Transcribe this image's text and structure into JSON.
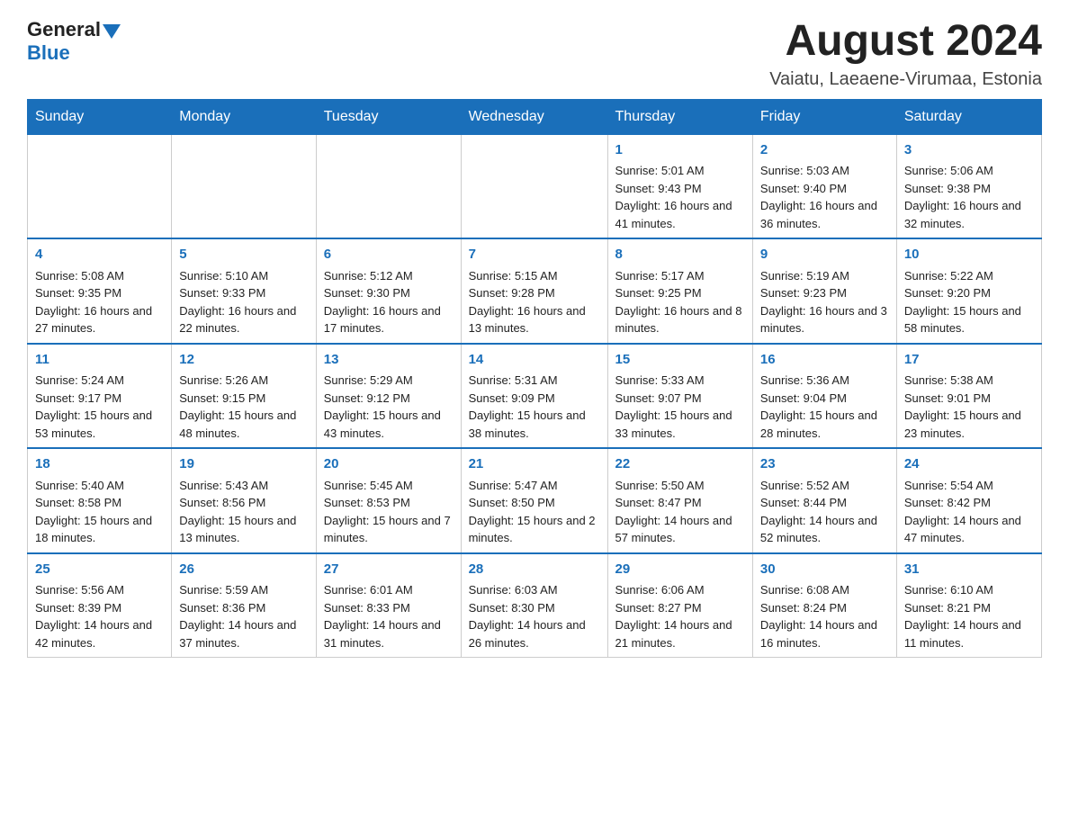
{
  "logo": {
    "general": "General",
    "blue": "Blue"
  },
  "header": {
    "month_year": "August 2024",
    "location": "Vaiatu, Laeaene-Virumaa, Estonia"
  },
  "weekdays": [
    "Sunday",
    "Monday",
    "Tuesday",
    "Wednesday",
    "Thursday",
    "Friday",
    "Saturday"
  ],
  "weeks": [
    [
      {
        "day": "",
        "info": ""
      },
      {
        "day": "",
        "info": ""
      },
      {
        "day": "",
        "info": ""
      },
      {
        "day": "",
        "info": ""
      },
      {
        "day": "1",
        "info": "Sunrise: 5:01 AM\nSunset: 9:43 PM\nDaylight: 16 hours and 41 minutes."
      },
      {
        "day": "2",
        "info": "Sunrise: 5:03 AM\nSunset: 9:40 PM\nDaylight: 16 hours and 36 minutes."
      },
      {
        "day": "3",
        "info": "Sunrise: 5:06 AM\nSunset: 9:38 PM\nDaylight: 16 hours and 32 minutes."
      }
    ],
    [
      {
        "day": "4",
        "info": "Sunrise: 5:08 AM\nSunset: 9:35 PM\nDaylight: 16 hours and 27 minutes."
      },
      {
        "day": "5",
        "info": "Sunrise: 5:10 AM\nSunset: 9:33 PM\nDaylight: 16 hours and 22 minutes."
      },
      {
        "day": "6",
        "info": "Sunrise: 5:12 AM\nSunset: 9:30 PM\nDaylight: 16 hours and 17 minutes."
      },
      {
        "day": "7",
        "info": "Sunrise: 5:15 AM\nSunset: 9:28 PM\nDaylight: 16 hours and 13 minutes."
      },
      {
        "day": "8",
        "info": "Sunrise: 5:17 AM\nSunset: 9:25 PM\nDaylight: 16 hours and 8 minutes."
      },
      {
        "day": "9",
        "info": "Sunrise: 5:19 AM\nSunset: 9:23 PM\nDaylight: 16 hours and 3 minutes."
      },
      {
        "day": "10",
        "info": "Sunrise: 5:22 AM\nSunset: 9:20 PM\nDaylight: 15 hours and 58 minutes."
      }
    ],
    [
      {
        "day": "11",
        "info": "Sunrise: 5:24 AM\nSunset: 9:17 PM\nDaylight: 15 hours and 53 minutes."
      },
      {
        "day": "12",
        "info": "Sunrise: 5:26 AM\nSunset: 9:15 PM\nDaylight: 15 hours and 48 minutes."
      },
      {
        "day": "13",
        "info": "Sunrise: 5:29 AM\nSunset: 9:12 PM\nDaylight: 15 hours and 43 minutes."
      },
      {
        "day": "14",
        "info": "Sunrise: 5:31 AM\nSunset: 9:09 PM\nDaylight: 15 hours and 38 minutes."
      },
      {
        "day": "15",
        "info": "Sunrise: 5:33 AM\nSunset: 9:07 PM\nDaylight: 15 hours and 33 minutes."
      },
      {
        "day": "16",
        "info": "Sunrise: 5:36 AM\nSunset: 9:04 PM\nDaylight: 15 hours and 28 minutes."
      },
      {
        "day": "17",
        "info": "Sunrise: 5:38 AM\nSunset: 9:01 PM\nDaylight: 15 hours and 23 minutes."
      }
    ],
    [
      {
        "day": "18",
        "info": "Sunrise: 5:40 AM\nSunset: 8:58 PM\nDaylight: 15 hours and 18 minutes."
      },
      {
        "day": "19",
        "info": "Sunrise: 5:43 AM\nSunset: 8:56 PM\nDaylight: 15 hours and 13 minutes."
      },
      {
        "day": "20",
        "info": "Sunrise: 5:45 AM\nSunset: 8:53 PM\nDaylight: 15 hours and 7 minutes."
      },
      {
        "day": "21",
        "info": "Sunrise: 5:47 AM\nSunset: 8:50 PM\nDaylight: 15 hours and 2 minutes."
      },
      {
        "day": "22",
        "info": "Sunrise: 5:50 AM\nSunset: 8:47 PM\nDaylight: 14 hours and 57 minutes."
      },
      {
        "day": "23",
        "info": "Sunrise: 5:52 AM\nSunset: 8:44 PM\nDaylight: 14 hours and 52 minutes."
      },
      {
        "day": "24",
        "info": "Sunrise: 5:54 AM\nSunset: 8:42 PM\nDaylight: 14 hours and 47 minutes."
      }
    ],
    [
      {
        "day": "25",
        "info": "Sunrise: 5:56 AM\nSunset: 8:39 PM\nDaylight: 14 hours and 42 minutes."
      },
      {
        "day": "26",
        "info": "Sunrise: 5:59 AM\nSunset: 8:36 PM\nDaylight: 14 hours and 37 minutes."
      },
      {
        "day": "27",
        "info": "Sunrise: 6:01 AM\nSunset: 8:33 PM\nDaylight: 14 hours and 31 minutes."
      },
      {
        "day": "28",
        "info": "Sunrise: 6:03 AM\nSunset: 8:30 PM\nDaylight: 14 hours and 26 minutes."
      },
      {
        "day": "29",
        "info": "Sunrise: 6:06 AM\nSunset: 8:27 PM\nDaylight: 14 hours and 21 minutes."
      },
      {
        "day": "30",
        "info": "Sunrise: 6:08 AM\nSunset: 8:24 PM\nDaylight: 14 hours and 16 minutes."
      },
      {
        "day": "31",
        "info": "Sunrise: 6:10 AM\nSunset: 8:21 PM\nDaylight: 14 hours and 11 minutes."
      }
    ]
  ]
}
